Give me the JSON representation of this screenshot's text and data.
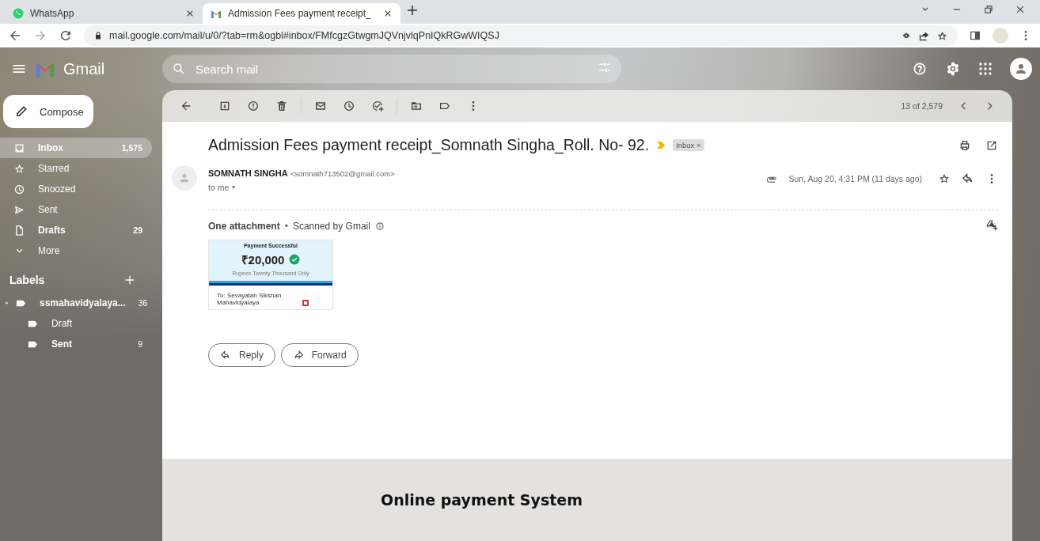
{
  "browser": {
    "tabs": [
      {
        "title": "WhatsApp",
        "kind": "whatsapp",
        "selected": false
      },
      {
        "title": "Admission Fees payment receipt_",
        "kind": "gmail",
        "selected": true
      }
    ],
    "url": "mail.google.com/mail/u/0/?tab=rm&ogbl#inbox/FMfcgzGtwgmJQVnjvlqPnIQkRGwWIQSJ"
  },
  "gmail": {
    "logo_text": "Gmail",
    "search": {
      "placeholder": "Search mail"
    },
    "compose": "Compose",
    "nav": [
      {
        "kind": "inbox",
        "label": "Inbox",
        "count": "1,575",
        "bold": true,
        "selected": true
      },
      {
        "kind": "star",
        "label": "Starred",
        "bold": false,
        "selected": false
      },
      {
        "kind": "clock",
        "label": "Snoozed",
        "bold": false,
        "selected": false
      },
      {
        "kind": "send",
        "label": "Sent",
        "bold": false,
        "selected": false
      },
      {
        "kind": "file",
        "label": "Drafts",
        "count": "29",
        "bold": true,
        "selected": false
      },
      {
        "kind": "chevron",
        "label": "More",
        "bold": false,
        "selected": false
      }
    ],
    "labels_heading": "Labels",
    "labels": [
      {
        "label": "ssmahavidyalaya...",
        "count": "36",
        "bold": true,
        "expanded": true,
        "children": [
          {
            "label": "Draft",
            "bold": false
          },
          {
            "label": "Sent",
            "count": "9",
            "bold": true
          }
        ]
      }
    ],
    "pager": "13 of 2,579",
    "message": {
      "subject": "Admission Fees payment receipt_Somnath Singha_Roll. No- 92.",
      "tag": "Inbox ×",
      "sender": "SOMNATH SINGHA",
      "email": "<somnath713502@gmail.com>",
      "to": "to me",
      "date": "Sun, Aug 20, 4:31 PM (11 days ago)",
      "attachments_title": "One attachment",
      "separator": "•",
      "scanned": "Scanned by Gmail",
      "attachment": {
        "heading": "Payment Successful",
        "amount": "₹20,000",
        "words": "Rupees Twenty Thousand Only",
        "payee": "To: Sevayatan Sikshan Mahavidyalaya"
      },
      "buttons": [
        "Reply",
        "Forward"
      ]
    },
    "footer_text": "Online payment System"
  }
}
